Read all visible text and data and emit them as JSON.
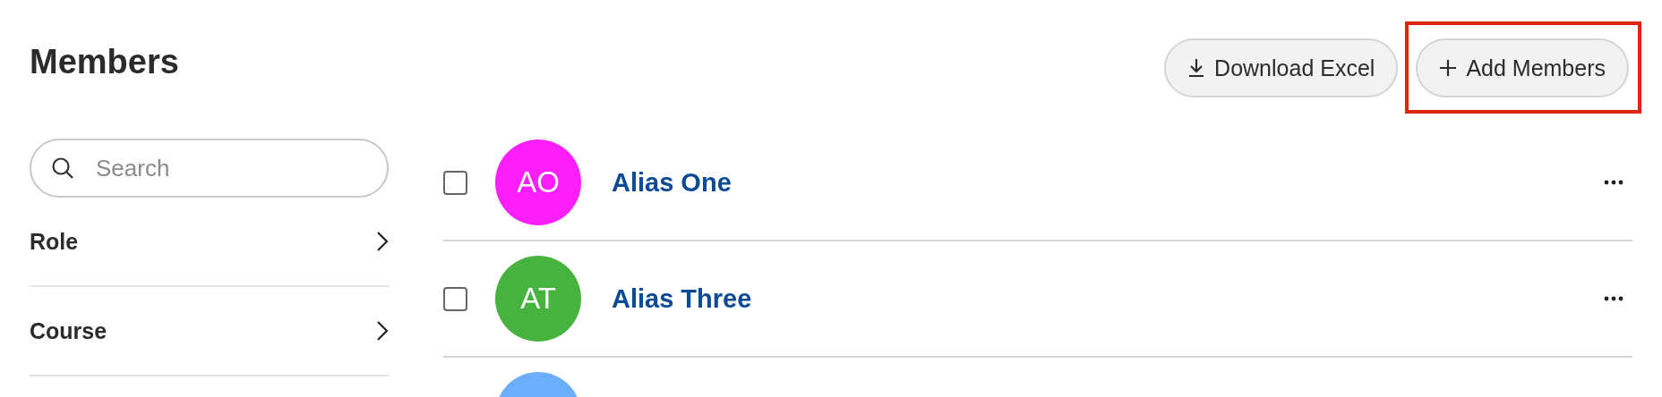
{
  "page": {
    "title": "Members"
  },
  "actions": [
    {
      "kind": "download",
      "label": "Download Excel",
      "highlighted": false
    },
    {
      "kind": "add",
      "label": "Add Members",
      "highlighted": true
    }
  ],
  "search": {
    "placeholder": "Search"
  },
  "filters": [
    {
      "label": "Role",
      "expanded": false
    },
    {
      "label": "Course",
      "expanded": false
    }
  ],
  "members": [
    {
      "initials": "AO",
      "name": "Alias One",
      "color": "#fc1ffc",
      "checked": false
    },
    {
      "initials": "AT",
      "name": "Alias Three",
      "color": "#47b33f",
      "checked": false
    },
    {
      "color": "#6aaefc"
    }
  ]
}
